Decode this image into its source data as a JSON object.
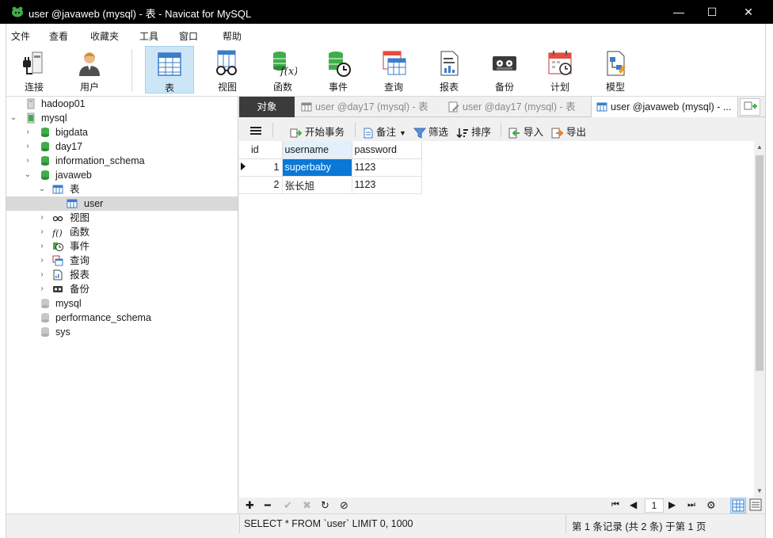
{
  "window": {
    "title": "user @javaweb (mysql) - 表 - Navicat for MySQL",
    "controls": {
      "minimize": "—",
      "maximize": "☐",
      "close": "✕"
    }
  },
  "menu": [
    "文件",
    "查看",
    "收藏夹",
    "工具",
    "窗口",
    "帮助"
  ],
  "toolbar": [
    {
      "label": "连接",
      "icon": "connection-plug-icon"
    },
    {
      "label": "用户",
      "icon": "user-icon"
    },
    {
      "label": "表",
      "icon": "table-icon",
      "active": true
    },
    {
      "label": "视图",
      "icon": "view-glasses-icon"
    },
    {
      "label": "函数",
      "icon": "function-icon"
    },
    {
      "label": "事件",
      "icon": "event-clock-icon"
    },
    {
      "label": "查询",
      "icon": "query-icon"
    },
    {
      "label": "报表",
      "icon": "report-icon"
    },
    {
      "label": "备份",
      "icon": "backup-icon"
    },
    {
      "label": "计划",
      "icon": "schedule-calendar-icon"
    },
    {
      "label": "模型",
      "icon": "model-icon"
    }
  ],
  "navigator": {
    "connections": [
      {
        "name": "hadoop01",
        "open": false
      },
      {
        "name": "mysql",
        "open": true
      }
    ],
    "databases": [
      "bigdata",
      "day17",
      "information_schema",
      "javaweb"
    ],
    "javaweb_children": {
      "tables_label": "表",
      "table_items": [
        "user"
      ]
    },
    "object_groups": [
      "视图",
      "函数",
      "事件",
      "查询",
      "报表",
      "备份"
    ],
    "closed_databases": [
      "mysql",
      "performance_schema",
      "sys"
    ]
  },
  "tabs": {
    "objects": "对象",
    "items": [
      {
        "label": "user @day17 (mysql) - 表",
        "state": "inactive"
      },
      {
        "label": "user @day17 (mysql) - 表",
        "state": "inactive"
      },
      {
        "label": "user @javaweb (mysql) - ...",
        "state": "active"
      }
    ]
  },
  "grid_toolbar": {
    "menu_icon": "hamburger-menu-icon",
    "begin_transaction": "开始事务",
    "notes": "备注",
    "filter": "筛选",
    "sort": "排序",
    "import": "导入",
    "export": "导出"
  },
  "table": {
    "columns": [
      "id",
      "username",
      "password"
    ],
    "rows": [
      [
        "1",
        "superbaby",
        "1123"
      ],
      [
        "2",
        "张长旭",
        "1123"
      ]
    ]
  },
  "pager": {
    "page": "1"
  },
  "status": {
    "sql": "SELECT * FROM `user` LIMIT 0, 1000",
    "record": "第 1 条记录 (共 2 条) 于第 1 页"
  },
  "colors": {
    "titlebar": "#000000",
    "active_toolbar": "#cde6f7",
    "selected_cell": "#0a78d7",
    "db_icon": "#3fae49"
  }
}
